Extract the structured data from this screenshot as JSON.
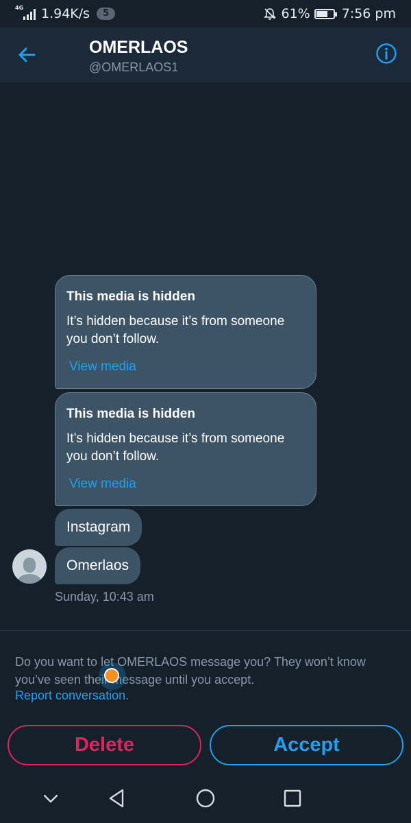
{
  "status_bar": {
    "network_tag": "4G",
    "speed": "1.94K/s",
    "notification_count": "5",
    "battery": "61%",
    "time": "7:56 pm"
  },
  "header": {
    "title": "OMERLAOS",
    "handle": "@OMERLAOS1"
  },
  "messages": {
    "media_cards": [
      {
        "title": "This media is hidden",
        "body": "It’s hidden because it’s from someone you don’t follow.",
        "link": "View media"
      },
      {
        "title": "This media is hidden",
        "body": "It’s hidden because it’s from someone you don’t follow.",
        "link": "View media"
      }
    ],
    "texts": [
      "Instagram",
      "Omerlaos"
    ],
    "timestamp": "Sunday, 10:43 am"
  },
  "request": {
    "prompt": "Do you want to let OMERLAOS message you? They won’t know you’ve seen their message until you accept.",
    "report_link": "Report conversation.",
    "delete_label": "Delete",
    "accept_label": "Accept"
  },
  "colors": {
    "background": "#15202b",
    "header": "#1c2938",
    "bubble": "#3d5466",
    "accent": "#1da1f2",
    "danger": "#e0245e",
    "muted": "#8899a6"
  },
  "icons": {
    "back": "arrow-left-icon",
    "info": "info-circle-icon",
    "nav_collapse": "chevron-down-icon",
    "nav_back": "triangle-back-icon",
    "nav_home": "circle-home-icon",
    "nav_recents": "square-recents-icon"
  }
}
